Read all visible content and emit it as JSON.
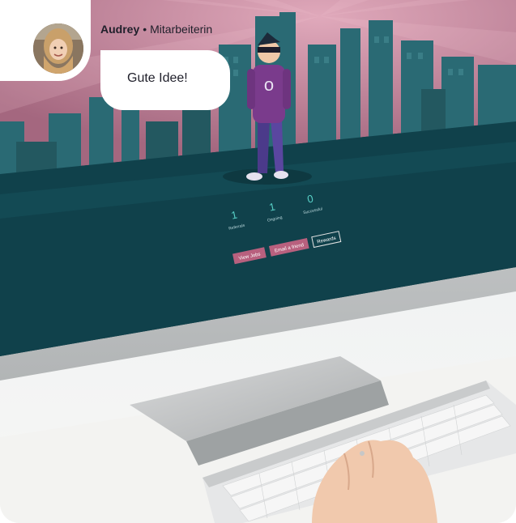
{
  "chat": {
    "author_name": "Audrey",
    "separator": "•",
    "author_role": "Mitarbeiterin",
    "message": "Gute Idee!"
  },
  "screen": {
    "stats": [
      {
        "value": "1",
        "label": "Referrals"
      },
      {
        "value": "1",
        "label": "Ongoing"
      },
      {
        "value": "0",
        "label": "Successful"
      }
    ],
    "buttons": [
      "View Jobs",
      "Email a friend",
      "Rewards"
    ]
  },
  "colors": {
    "sky": "#b87a8f",
    "city": "#1f5f69",
    "ground": "#0f3a44",
    "accent_button": "#b8607e"
  }
}
